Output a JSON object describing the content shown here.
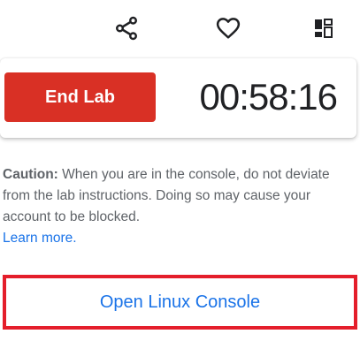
{
  "toolbar": {
    "icons": [
      "share-icon",
      "heart-icon",
      "dashboard-icon"
    ]
  },
  "lab": {
    "end_label": "End Lab",
    "timer": "00:58:16",
    "accent_color": "#d93025"
  },
  "caution": {
    "prefix": "Caution:",
    "text": " When you are in the console, do not deviate from the lab instructions. Doing so may cause your account to be blocked.",
    "link": "Learn more."
  },
  "console": {
    "label": "Open Linux Console",
    "link_color": "#1a73e8",
    "highlight_color": "#e41e2b"
  }
}
